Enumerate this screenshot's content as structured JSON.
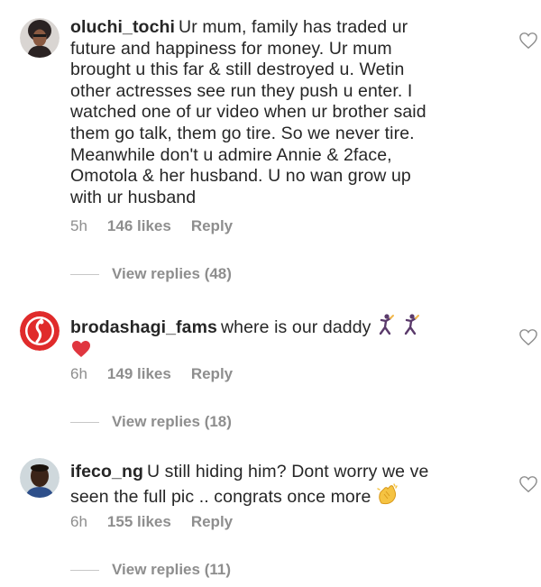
{
  "colors": {
    "text": "#262626",
    "secondary": "#8e8e8e",
    "divider": "#c7c7c7"
  },
  "comments": [
    {
      "username": "oluchi_tochi",
      "lines": [
        "Ur mum, family has traded ur",
        "future and happiness for money. Ur mum",
        "brought u this far & still destroyed u. Wetin",
        "other actresses see run they push u enter. I",
        "watched one of ur video when ur brother said",
        "them go talk, them go tire. So we never tire.",
        "Meanwhile don't u admire Annie & 2face,",
        "Omotola & her husband. U no wan grow up",
        "with ur husband"
      ],
      "time": "5h",
      "likes": "146 likes",
      "reply": "Reply",
      "view_replies": "View replies (48)",
      "avatar_icon": "profile-photo-icon",
      "like_icon": "heart-outline-icon"
    },
    {
      "username": "brodashagi_fams",
      "text": "where is our daddy",
      "time": "6h",
      "likes": "149 likes",
      "reply": "Reply",
      "view_replies": "View replies (18)",
      "avatar_icon": "red-logo-icon",
      "emojis": [
        "dancing-man-icon",
        "dancing-man-icon",
        "red-heart-icon"
      ],
      "like_icon": "heart-outline-icon"
    },
    {
      "username": "ifeco_ng",
      "lines": [
        "U still hiding him? Dont worry we ve",
        "seen the full pic .. congrats once more"
      ],
      "time": "6h",
      "likes": "155 likes",
      "reply": "Reply",
      "view_replies": "View replies (11)",
      "avatar_icon": "profile-photo-icon",
      "emojis": [
        "clapping-hands-icon"
      ],
      "like_icon": "heart-outline-icon"
    }
  ]
}
